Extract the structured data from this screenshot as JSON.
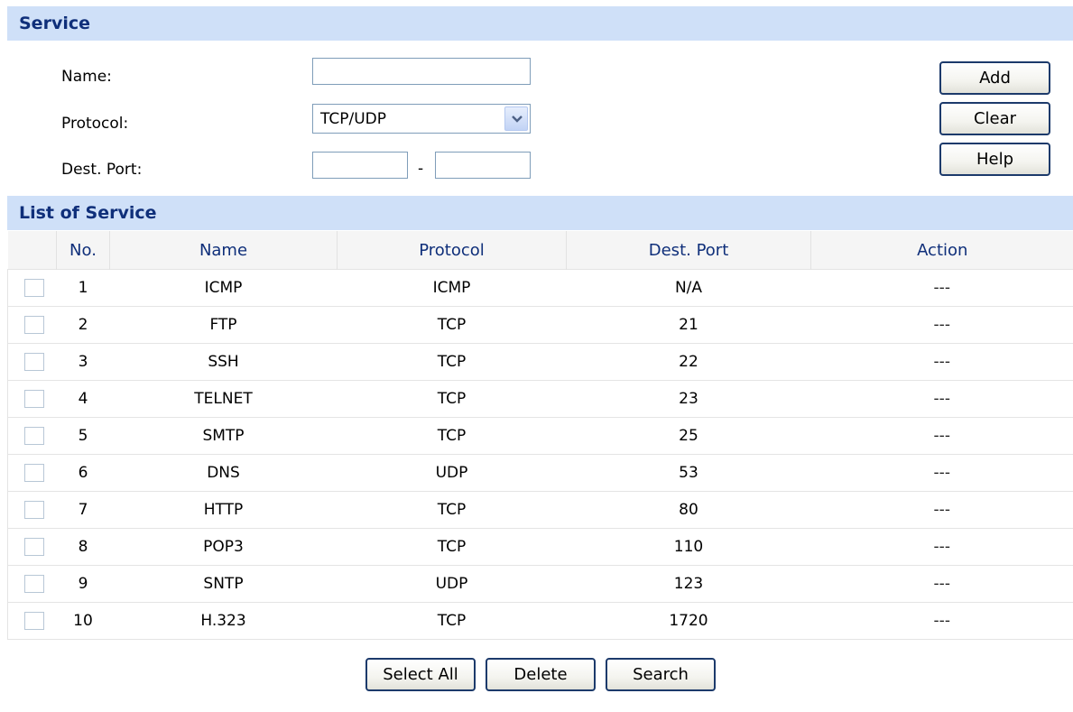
{
  "service_section": {
    "title": "Service",
    "name_label": "Name:",
    "name_value": "",
    "protocol_label": "Protocol:",
    "protocol_selected": "TCP/UDP",
    "dest_port_label": "Dest. Port:",
    "port_from": "",
    "port_separator": "-",
    "port_to": "",
    "buttons": {
      "add": "Add",
      "clear": "Clear",
      "help": "Help"
    }
  },
  "list_section": {
    "title": "List of Service",
    "columns": [
      "No.",
      "Name",
      "Protocol",
      "Dest. Port",
      "Action"
    ],
    "rows": [
      {
        "no": "1",
        "name": "ICMP",
        "protocol": "ICMP",
        "dest_port": "N/A",
        "action": "---"
      },
      {
        "no": "2",
        "name": "FTP",
        "protocol": "TCP",
        "dest_port": "21",
        "action": "---"
      },
      {
        "no": "3",
        "name": "SSH",
        "protocol": "TCP",
        "dest_port": "22",
        "action": "---"
      },
      {
        "no": "4",
        "name": "TELNET",
        "protocol": "TCP",
        "dest_port": "23",
        "action": "---"
      },
      {
        "no": "5",
        "name": "SMTP",
        "protocol": "TCP",
        "dest_port": "25",
        "action": "---"
      },
      {
        "no": "6",
        "name": "DNS",
        "protocol": "UDP",
        "dest_port": "53",
        "action": "---"
      },
      {
        "no": "7",
        "name": "HTTP",
        "protocol": "TCP",
        "dest_port": "80",
        "action": "---"
      },
      {
        "no": "8",
        "name": "POP3",
        "protocol": "TCP",
        "dest_port": "110",
        "action": "---"
      },
      {
        "no": "9",
        "name": "SNTP",
        "protocol": "UDP",
        "dest_port": "123",
        "action": "---"
      },
      {
        "no": "10",
        "name": "H.323",
        "protocol": "TCP",
        "dest_port": "1720",
        "action": "---"
      }
    ]
  },
  "bottom_buttons": {
    "select_all": "Select All",
    "delete": "Delete",
    "search": "Search"
  },
  "colors": {
    "header_bg": "#cfe0f8",
    "header_text": "#0f2f7a",
    "button_border": "#1c3a6b"
  }
}
